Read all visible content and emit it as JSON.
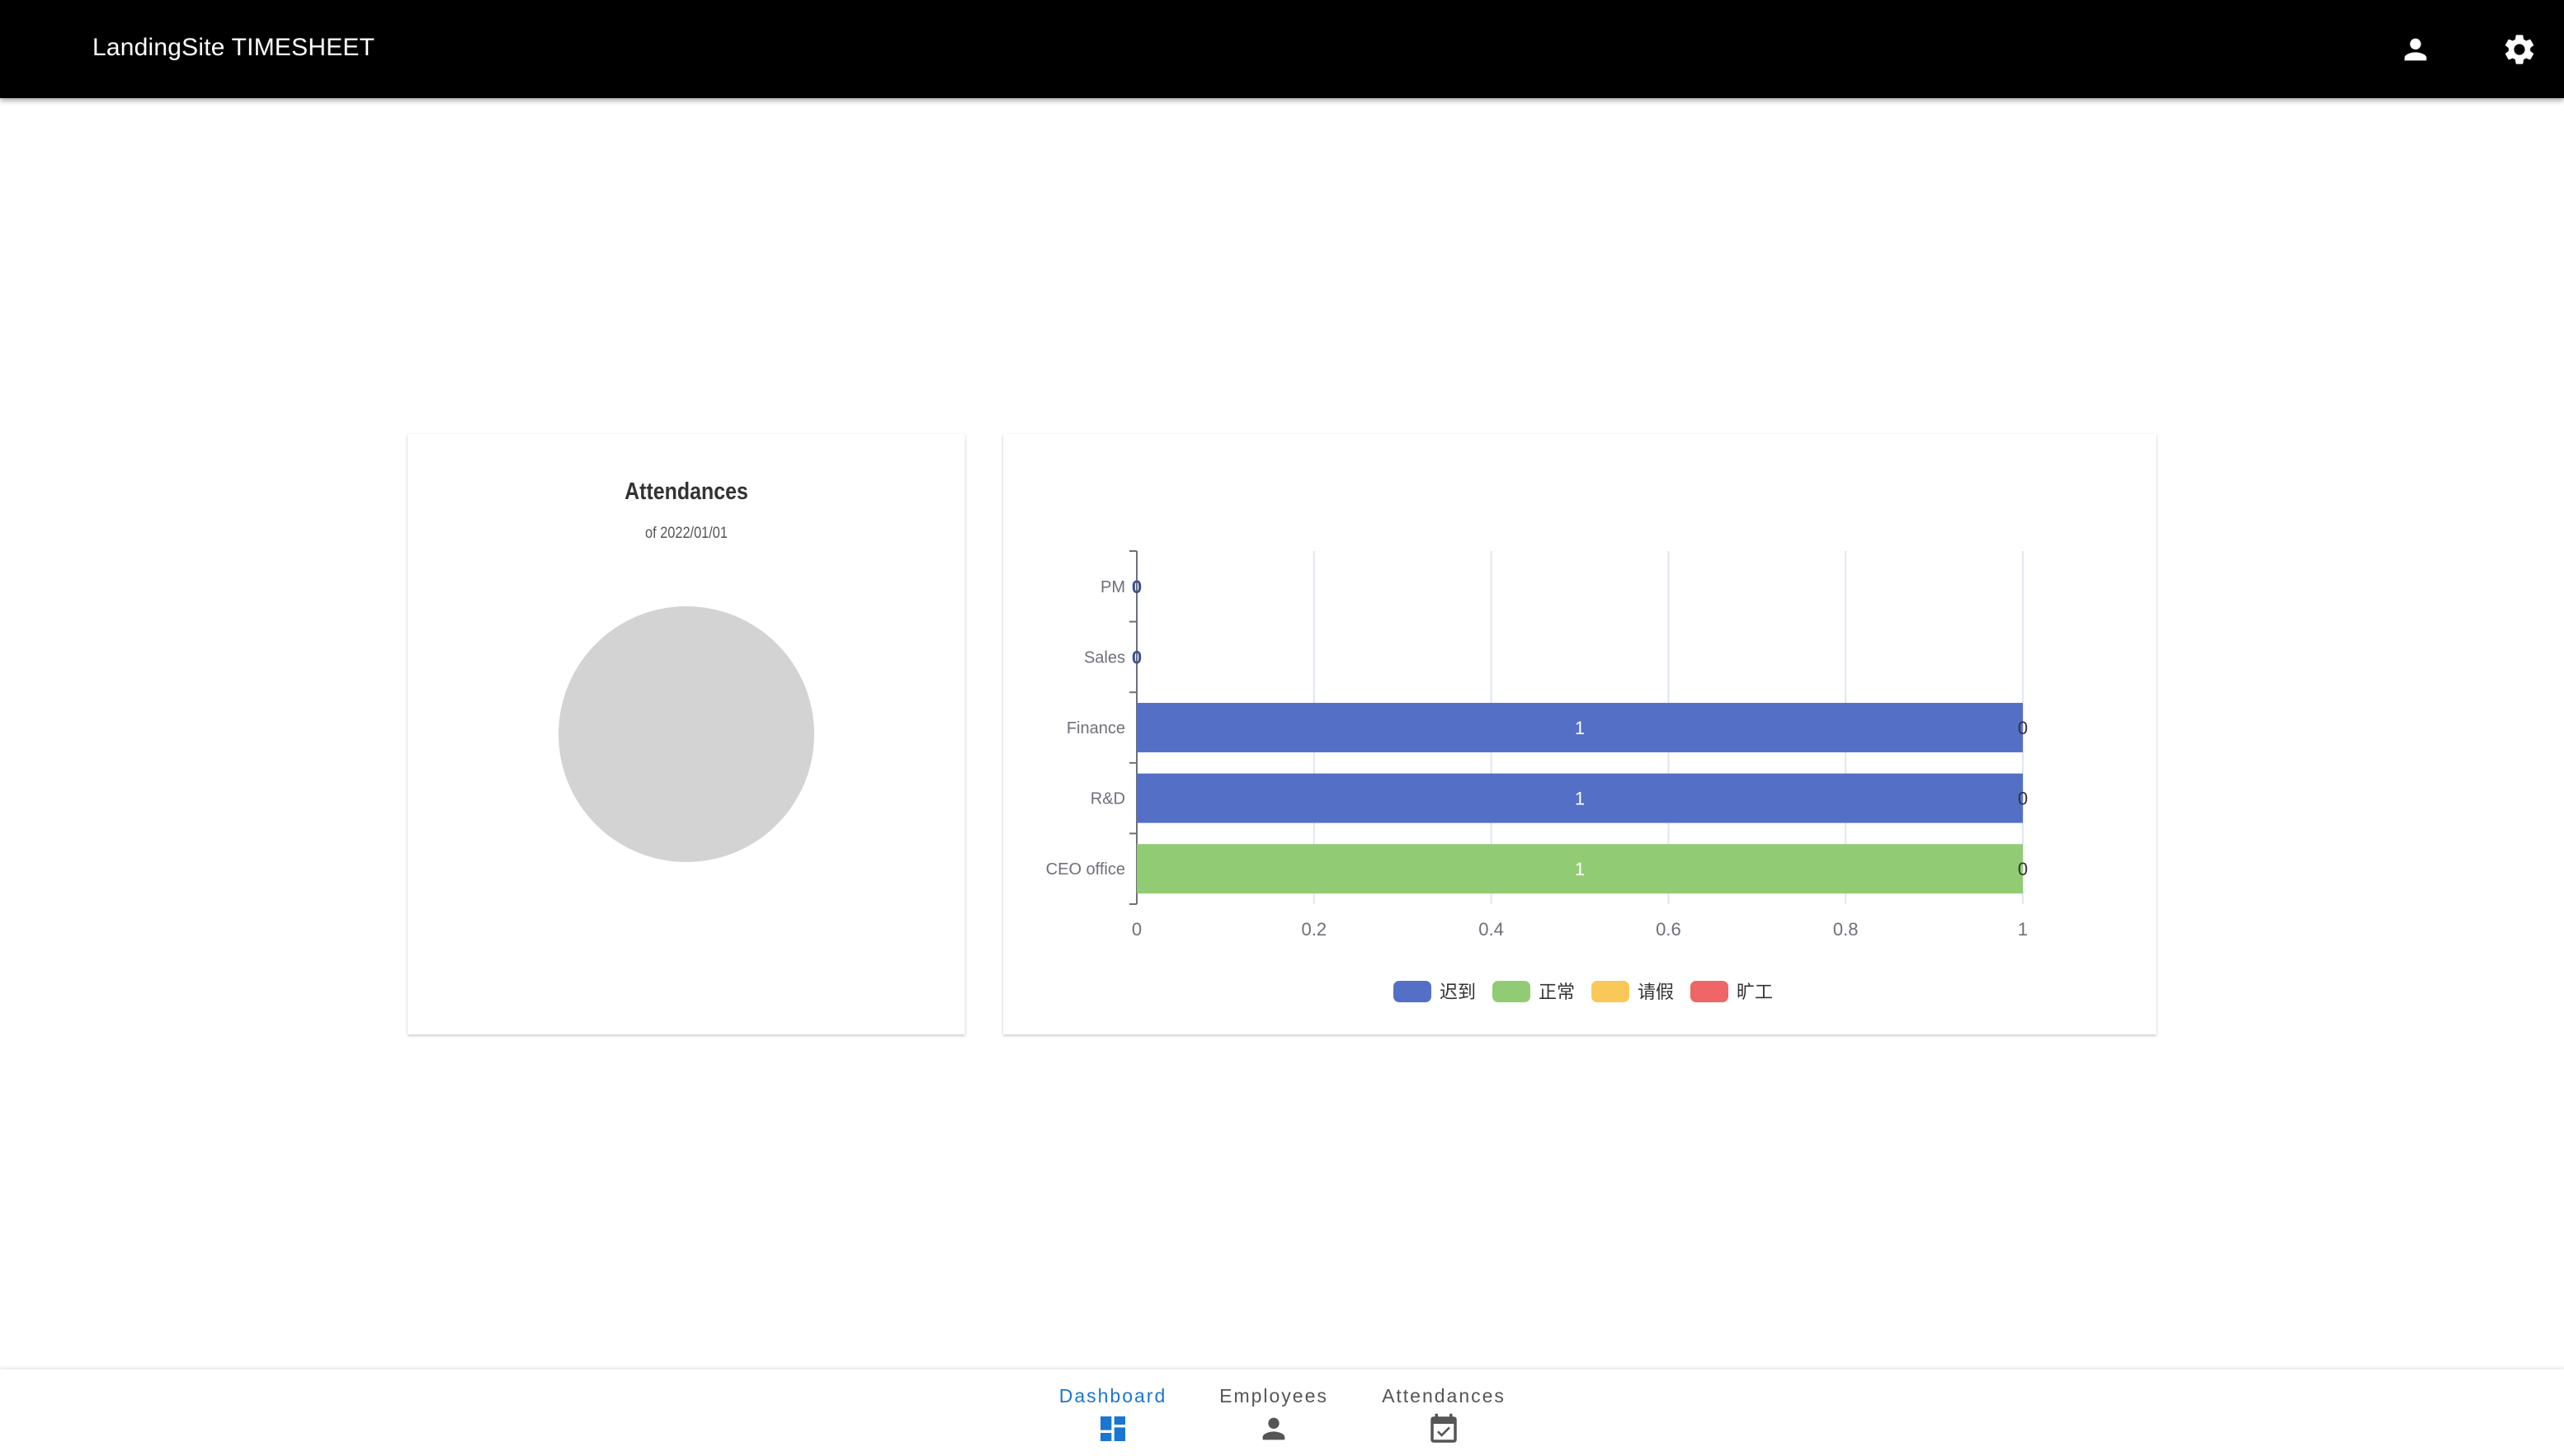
{
  "app": {
    "title": "LandingSite TIMESHEET"
  },
  "header": {
    "icons": [
      "person-icon",
      "gear-icon"
    ]
  },
  "colors": {
    "appbar": "#000000",
    "active_nav": "#1976d2",
    "pie_empty": "#d3d3d3"
  },
  "pie_card": {
    "title": "Attendances",
    "subtitle": "of 2022/01/01"
  },
  "nav": {
    "items": [
      {
        "label": "Dashboard",
        "icon": "dashboard-icon",
        "active": true
      },
      {
        "label": "Employees",
        "icon": "person-icon",
        "active": false
      },
      {
        "label": "Attendances",
        "icon": "calendar-check-icon",
        "active": false
      }
    ]
  },
  "chart_data": [
    {
      "type": "pie",
      "title": "Attendances",
      "subtitle": "of 2022/01/01",
      "slices": []
    },
    {
      "type": "bar",
      "orientation": "horizontal",
      "stacked": true,
      "categories": [
        "PM",
        "Sales",
        "Finance",
        "R&D",
        "CEO office"
      ],
      "series": [
        {
          "name": "迟到",
          "color": "#5470c6",
          "values": [
            0,
            0,
            1,
            1,
            0
          ]
        },
        {
          "name": "正常",
          "color": "#91cc75",
          "values": [
            0,
            0,
            0,
            0,
            1
          ]
        },
        {
          "name": "请假",
          "color": "#fac858",
          "values": [
            0,
            0,
            0,
            0,
            0
          ]
        },
        {
          "name": "旷工",
          "color": "#ee6666",
          "values": [
            0,
            0,
            0,
            0,
            0
          ]
        }
      ],
      "xlim": [
        0,
        1
      ],
      "xticks": [
        "0",
        "0.2",
        "0.4",
        "0.6",
        "0.8",
        "1"
      ],
      "grid": true,
      "legend": "bottom"
    }
  ]
}
